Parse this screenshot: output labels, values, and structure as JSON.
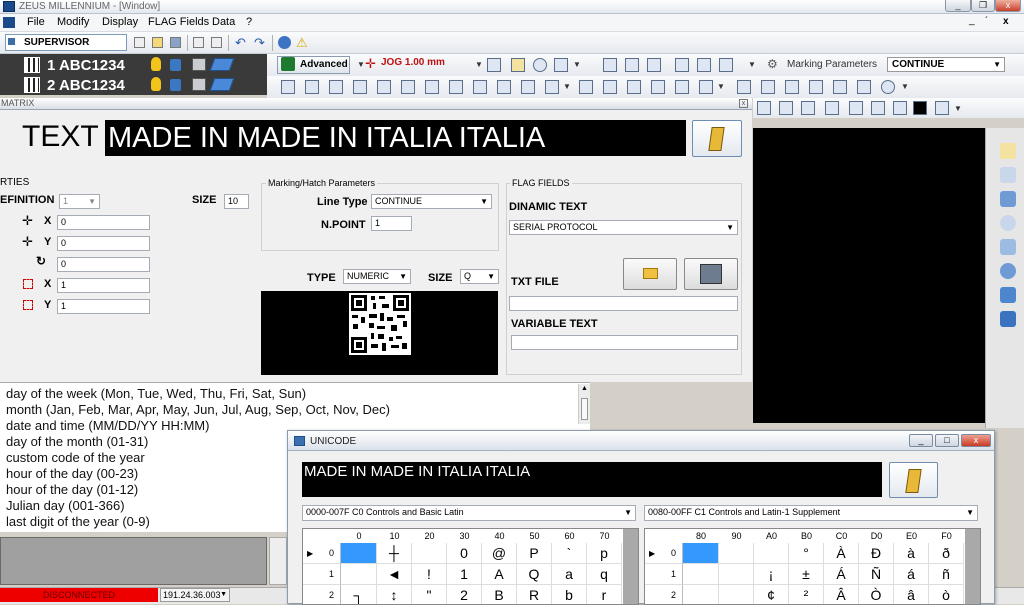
{
  "window": {
    "title": "ZEUS MILLENNIUM - [Window]"
  },
  "menu": [
    "File",
    "Modify",
    "Display",
    "FLAG Fields",
    "Data",
    "?"
  ],
  "mdi_controls": [
    "_",
    "´",
    "x"
  ],
  "toolbar": {
    "user": "SUPERVISOR",
    "advanced_label": "Advanced",
    "jog_label": "JOG 1.00 mm",
    "marking_params_label": "Marking Parameters",
    "marking_params_value": "CONTINUE"
  },
  "machines": [
    {
      "label": "1 ABC1234"
    },
    {
      "label": "2 ABC1234"
    }
  ],
  "matrix": {
    "title": "MATRIX",
    "text_label": "TEXT",
    "text_value": "MADE IN MADE IN ITALIA ITALIA",
    "properties_label": "RTIES",
    "definition_label": "EFINITION",
    "definition_value": "1",
    "size_label": "SIZE",
    "size_value": "10",
    "x_label": "X",
    "x_value": "0",
    "y_label": "Y",
    "y_value": "0",
    "rot_value": "0",
    "sx_label": "X",
    "sx_value": "1",
    "sy_label": "Y",
    "sy_value": "1",
    "marking_group": "Marking/Hatch Parameters",
    "line_type_label": "Line Type",
    "line_type_value": "CONTINUE",
    "npoint_label": "N.POINT",
    "npoint_value": "1",
    "type_label": "TYPE",
    "type_value": "NUMERIC",
    "size2_label": "SIZE",
    "size2_value": "Q",
    "flag_group": "FLAG FIELDS",
    "dinamic_label": "DINAMIC TEXT",
    "dinamic_value": "SERIAL PROTOCOL",
    "txt_file_label": "TXT FILE",
    "txt_file_value": "",
    "variable_text_label": "VARIABLE TEXT",
    "variable_text_value": ""
  },
  "codes_list": [
    "day of the week (Mon, Tue, Wed, Thu, Fri, Sat, Sun)",
    "month (Jan, Feb, Mar, Apr, May, Jun, Jul, Aug, Sep, Oct, Nov, Dec)",
    "date and time (MM/DD/YY HH:MM)",
    "day of the month (01-31)",
    "custom code of the year",
    "hour of the day (00-23)",
    "hour of the day (01-12)",
    "Julian day (001-366)",
    "last digit of the year (0-9)"
  ],
  "status": {
    "connection": "DISCONNECTED",
    "ip": "191.24.36.003"
  },
  "unicode": {
    "title": "UNICODE",
    "text_value": "MADE IN MADE IN ITALIA ITALIA",
    "range_left": "0000-007F C0 Controls and Basic Latin",
    "range_right": "0080-00FF C1 Controls and Latin-1 Supplement",
    "left_cols": [
      "0",
      "10",
      "20",
      "30",
      "40",
      "50",
      "60",
      "70"
    ],
    "left_rows": [
      {
        "idx": "0",
        "cells": [
          "",
          "┼",
          "",
          "0",
          "@",
          "P",
          "`",
          "p"
        ]
      },
      {
        "idx": "1",
        "cells": [
          "",
          "◄",
          "!",
          "1",
          "A",
          "Q",
          "a",
          "q"
        ]
      },
      {
        "idx": "2",
        "cells": [
          "┐",
          "↕",
          "\"",
          "2",
          "B",
          "R",
          "b",
          "r"
        ]
      }
    ],
    "right_cols": [
      "80",
      "90",
      "A0",
      "B0",
      "C0",
      "D0",
      "E0",
      "F0"
    ],
    "right_rows": [
      {
        "idx": "0",
        "cells": [
          "",
          "",
          "",
          "°",
          "À",
          "Ð",
          "à",
          "ð"
        ]
      },
      {
        "idx": "1",
        "cells": [
          "",
          "",
          "¡",
          "±",
          "Á",
          "Ñ",
          "á",
          "ñ"
        ]
      },
      {
        "idx": "2",
        "cells": [
          "",
          "",
          "¢",
          "²",
          "Â",
          "Ò",
          "â",
          "ò"
        ]
      }
    ]
  },
  "colors": {
    "accent": "#3399ff",
    "disconnected": "#ee0000"
  }
}
